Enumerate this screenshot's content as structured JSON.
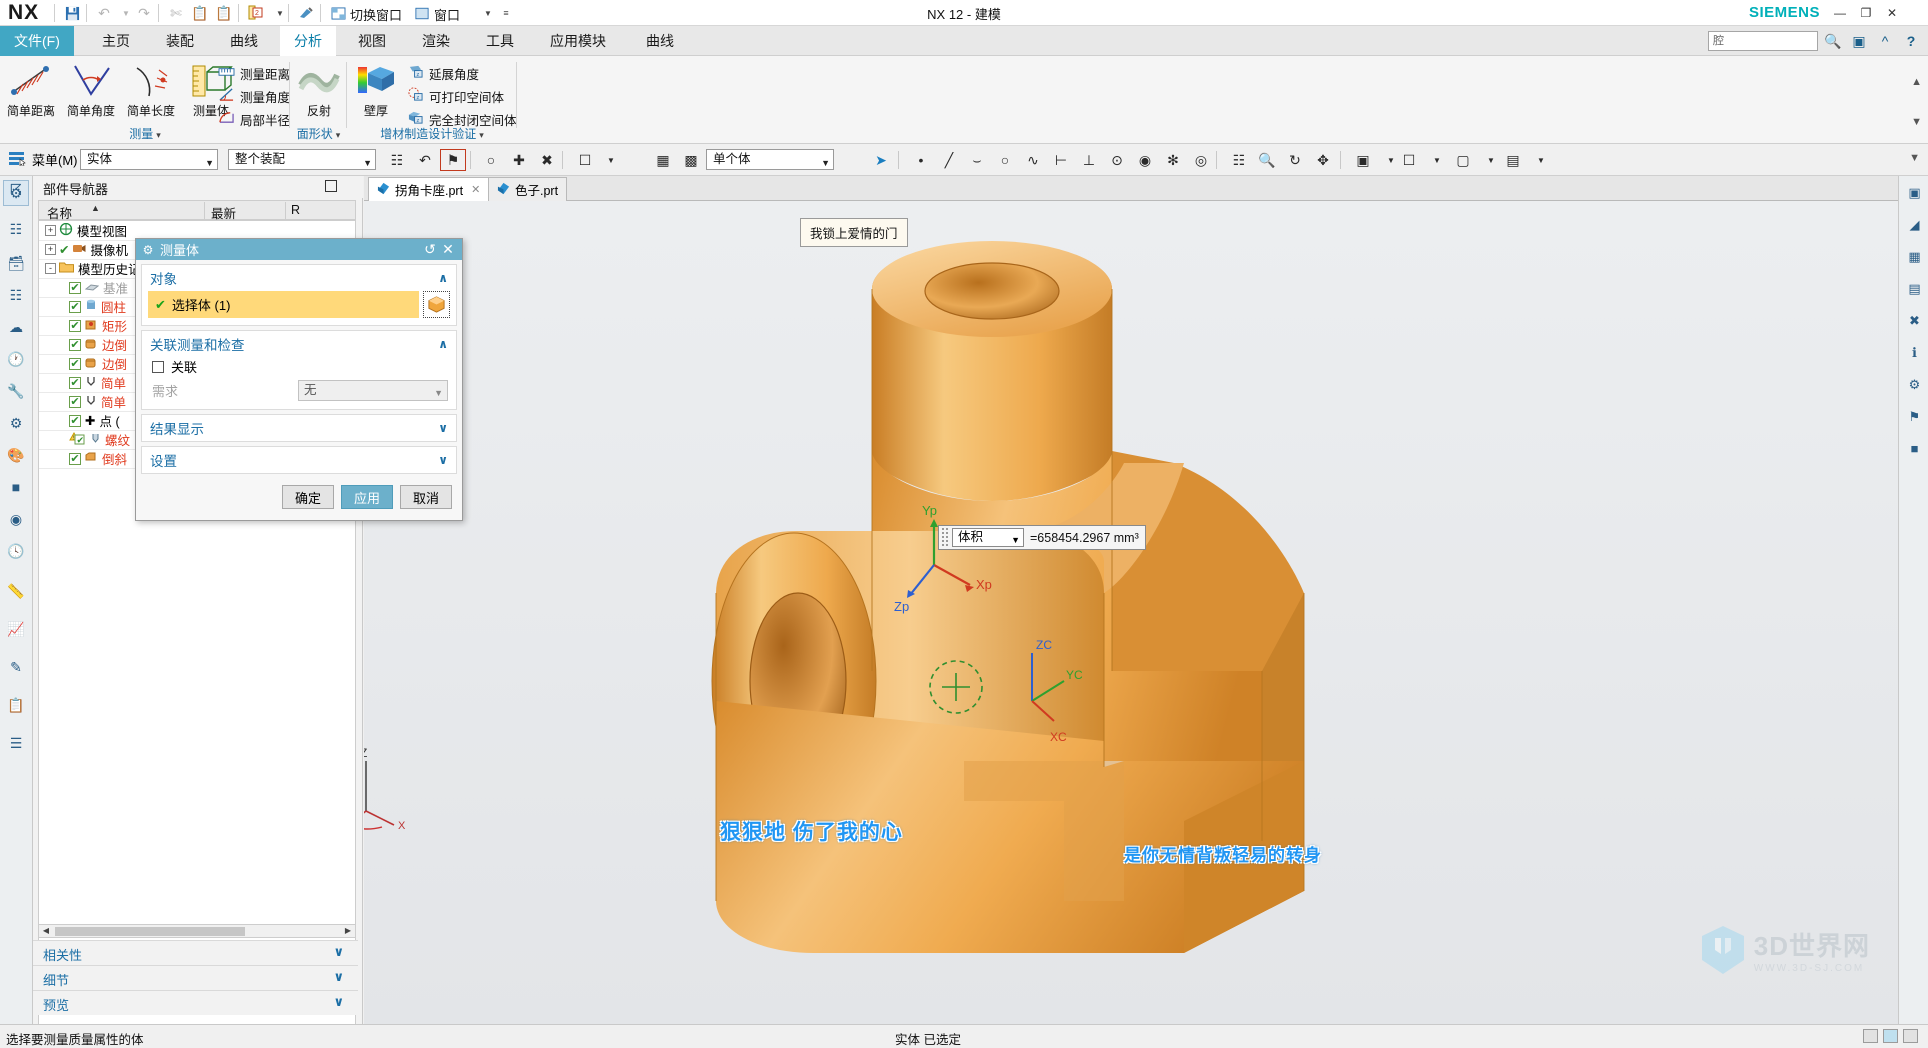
{
  "titlebar": {
    "logo": "NX",
    "window_title": "NX 12 - 建模",
    "brand": "SIEMENS",
    "buttons": [
      {
        "name": "save-icon",
        "glyph": "ὋE"
      },
      {
        "name": "switch-window-label",
        "label": "切换窗口"
      },
      {
        "name": "window-label",
        "label": "窗口"
      }
    ],
    "switch_window": "切换窗口",
    "window": "窗口",
    "min": "—",
    "max": "❐",
    "close": "✕"
  },
  "menu": {
    "tabs": [
      {
        "label": "文件(F)",
        "state": "file"
      },
      {
        "label": "主页",
        "state": "normal"
      },
      {
        "label": "装配",
        "state": "normal"
      },
      {
        "label": "曲线",
        "state": "normal"
      },
      {
        "label": "分析",
        "state": "active"
      },
      {
        "label": "视图",
        "state": "normal"
      },
      {
        "label": "渲染",
        "state": "normal"
      },
      {
        "label": "工具",
        "state": "normal"
      },
      {
        "label": "应用模块",
        "state": "normal"
      },
      {
        "label": "曲线",
        "state": "normal"
      }
    ],
    "search_placeholder": "腔"
  },
  "ribbon": {
    "groups": [
      {
        "label": "测量",
        "caret": "▾"
      },
      {
        "label": "面形状",
        "caret": "▾"
      },
      {
        "label": "增材制造设计验证",
        "caret": "▾"
      }
    ],
    "measure_big": [
      {
        "label": "简单距离",
        "icon": "simple-distance-icon"
      },
      {
        "label": "简单角度",
        "icon": "simple-angle-icon"
      },
      {
        "label": "简单长度",
        "icon": "simple-length-icon"
      },
      {
        "label": "测量体",
        "icon": "measure-body-icon"
      }
    ],
    "measure_small": [
      {
        "label": "测量距离",
        "icon": "measure-distance-icon"
      },
      {
        "label": "测量角度",
        "icon": "measure-angle-icon"
      },
      {
        "label": "局部半径",
        "icon": "local-radius-icon"
      }
    ],
    "face_big": [
      {
        "label": "反射",
        "icon": "reflection-icon"
      }
    ],
    "am_big": [
      {
        "label": "壁厚",
        "icon": "wall-thickness-icon"
      }
    ],
    "am_small": [
      {
        "label": "延展角度",
        "icon": "draft-angle-icon"
      },
      {
        "label": "可打印空间体",
        "icon": "printable-volume-icon"
      },
      {
        "label": "完全封闭空间体",
        "icon": "fully-enclosed-volume-icon"
      }
    ]
  },
  "toolbar2": {
    "menu_label": "菜单(M)",
    "type_filter": "实体",
    "scope_filter": "整个装配",
    "body_filter": "单个体"
  },
  "part_navigator": {
    "title": "部件导航器",
    "columns": [
      "名称",
      "最新",
      "R"
    ],
    "sort_arrow": "▲",
    "items": [
      {
        "label": "模型视图",
        "indent": 0,
        "expander": "+",
        "check": false,
        "icon": "model-view-icon",
        "color": "#111"
      },
      {
        "label": "摄像机",
        "indent": 0,
        "expander": "+",
        "check": "green-check",
        "icon": "camera-icon",
        "color": "#111"
      },
      {
        "label": "模型历史记",
        "indent": 0,
        "expander": "-",
        "check": false,
        "icon": "folder-icon",
        "color": "#111"
      },
      {
        "label": "基准",
        "indent": 1,
        "expander": "",
        "check": true,
        "icon": "datum-icon",
        "color": "#9b9b9b"
      },
      {
        "label": "圆柱",
        "indent": 1,
        "expander": "",
        "check": true,
        "icon": "cylinder-icon",
        "color": "#e03a1e"
      },
      {
        "label": "矩形",
        "indent": 1,
        "expander": "",
        "check": true,
        "icon": "rect-pad-icon",
        "color": "#e03a1e"
      },
      {
        "label": "边倒",
        "indent": 1,
        "expander": "",
        "check": true,
        "icon": "edge-blend-icon",
        "color": "#e03a1e"
      },
      {
        "label": "边倒",
        "indent": 1,
        "expander": "",
        "check": true,
        "icon": "edge-blend-icon",
        "color": "#e03a1e"
      },
      {
        "label": "简单",
        "indent": 1,
        "expander": "",
        "check": true,
        "icon": "simple-hole-icon",
        "color": "#e03a1e"
      },
      {
        "label": "简单",
        "indent": 1,
        "expander": "",
        "check": true,
        "icon": "simple-hole-icon",
        "color": "#e03a1e"
      },
      {
        "label": "点 (",
        "indent": 1,
        "expander": "",
        "check": true,
        "icon": "point-icon",
        "color": "#111"
      },
      {
        "label": "螺纹",
        "indent": 1,
        "expander": "",
        "check": "warn",
        "icon": "thread-icon",
        "color": "#e03a1e"
      },
      {
        "label": "倒斜",
        "indent": 1,
        "expander": "",
        "check": true,
        "icon": "chamfer-icon",
        "color": "#e03a1e"
      }
    ],
    "accordions": [
      {
        "label": "相关性",
        "caret": "∨"
      },
      {
        "label": "细节",
        "caret": "∨"
      },
      {
        "label": "预览",
        "caret": "∨"
      }
    ]
  },
  "file_tabs": [
    {
      "label": "拐角卡座.prt",
      "active": true,
      "close": "✕"
    },
    {
      "label": "色子.prt",
      "active": false,
      "close": ""
    }
  ],
  "viewport": {
    "tooltip": "我锁上爱情的门",
    "measure_type": "体积",
    "measure_value": "=658454.2967 mm³",
    "csys_labels": [
      "Yp",
      "Xp",
      "Zp",
      "YC",
      "XC",
      "ZC"
    ],
    "wcs_label_z": "Z",
    "watermark_1": "狠狠地  伤了我的心",
    "watermark_2": "是你无情背叛轻易的转身",
    "logo_text": "3D世界网",
    "logo_sub": "WWW.3D-SJ.COM"
  },
  "dialog": {
    "title": "测量体",
    "reset_icon": "↺",
    "close_icon": "✕",
    "sections": [
      {
        "name": "object",
        "title": "对象",
        "caret": "∧",
        "expanded": true
      },
      {
        "name": "assoc",
        "title": "关联测量和检查",
        "caret": "∧",
        "expanded": true
      },
      {
        "name": "results",
        "title": "结果显示",
        "caret": "∨",
        "expanded": false
      },
      {
        "name": "settings",
        "title": "设置",
        "caret": "∨",
        "expanded": false
      }
    ],
    "select_body_label": "选择体 (1)",
    "select_check": "✔",
    "assoc_checkbox_label": "关联",
    "need_label": "需求",
    "need_value": "无",
    "buttons": [
      {
        "label": "确定",
        "primary": false
      },
      {
        "label": "应用",
        "primary": true
      },
      {
        "label": "取消",
        "primary": false
      }
    ]
  },
  "status": {
    "hint": "选择要测量质量属性的体",
    "selection": "实体 已选定"
  },
  "colors": {
    "accent": "#6cb0cb",
    "link": "#1b6ea5",
    "highlight": "#ffd97a",
    "siemens": "#00b0b9",
    "part": "#e8a04e"
  }
}
